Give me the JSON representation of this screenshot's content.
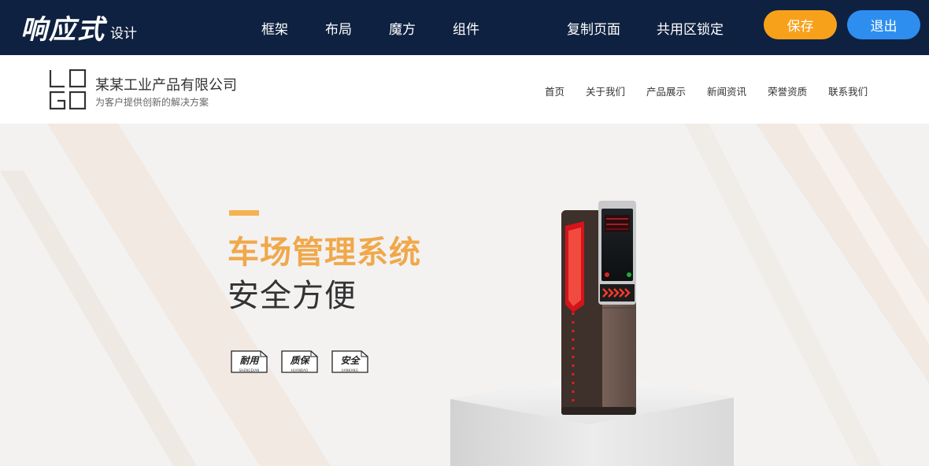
{
  "editor": {
    "brand_main": "响应式",
    "brand_sub": "设计",
    "nav_left": [
      "框架",
      "布局",
      "魔方",
      "组件"
    ],
    "nav_right": [
      "复制页面",
      "共用区锁定"
    ],
    "save_label": "保存",
    "exit_label": "退出",
    "colors": {
      "bar_bg": "#0f2140",
      "save": "#f7a11a",
      "exit": "#2e8ef0"
    }
  },
  "site": {
    "logo_letters": [
      "L",
      "O",
      "G",
      "O"
    ],
    "company_name": "某某工业产品有限公司",
    "slogan": "为客户提供创新的解决方案",
    "nav": [
      "首页",
      "关于我们",
      "产品展示",
      "新闻资讯",
      "荣誉资质",
      "联系我们"
    ]
  },
  "banner": {
    "headline": "车场管理系统",
    "subline": "安全方便",
    "badges": [
      {
        "label": "耐用",
        "sub": "SHENGDIAN"
      },
      {
        "label": "质保",
        "sub": "HUANBAO"
      },
      {
        "label": "安全",
        "sub": "JIANKANG"
      }
    ],
    "colors": {
      "accent": "#f0a84a"
    }
  }
}
